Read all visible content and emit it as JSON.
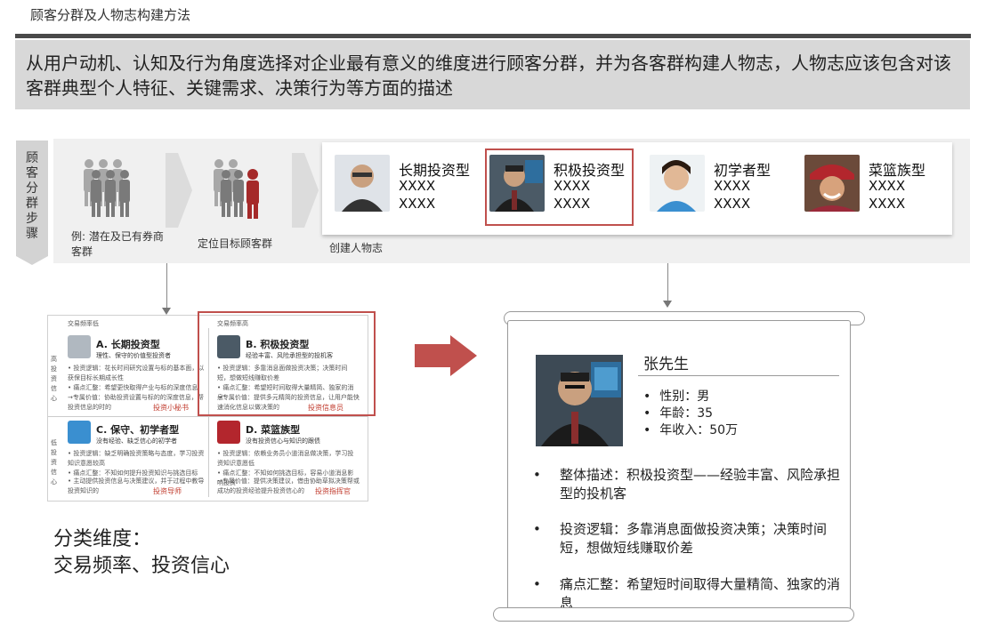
{
  "page_title": "顾客分群及人物志构建方法",
  "banner_text": "从用户动机、认知及行为角度选择对企业最有意义的维度进行顾客分群，并为各客群构建人物志，人物志应该包含对该客群典型个人特征、关键需求、决策行为等方面的描述",
  "steps_label": "顾客分群步骤",
  "steps": [
    {
      "caption": "例: 潜在及已有券商客群"
    },
    {
      "caption": "定位目标顾客群"
    }
  ],
  "personas_caption": "创建人物志",
  "personas": [
    {
      "name": "长期投资型",
      "line1": "XXXX",
      "line2": "XXXX"
    },
    {
      "name": "积极投资型",
      "line1": "XXXX",
      "line2": "XXXX"
    },
    {
      "name": "初学者型",
      "line1": "XXXX",
      "line2": "XXXX"
    },
    {
      "name": "菜篮族型",
      "line1": "XXXX",
      "line2": "XXXX"
    }
  ],
  "matrix": {
    "freq_low": "交易频率低",
    "freq_high": "交易频率高",
    "conf_high": "高投资信心",
    "conf_low": "低投资信心",
    "cells": [
      {
        "title": "A. 长期投资型",
        "sub": "理性、保守的价值型投资者",
        "lines": [
          "• 投资逻辑：花长时间研究设置与标的基本面，以获保目标长期成长性",
          "• 痛点汇整：希望更快取得产业与标的深度信息",
          "→专属价值：协助投资设置与标的的深度信息，帮投资信息的时的"
        ],
        "tag": "投资小秘书"
      },
      {
        "title": "B. 积极投资型",
        "sub": "经验丰富、风险承担型的投机客",
        "lines": [
          "• 投资逻辑：多靠消息面做投资决策；决策时间短，想做短线赚取价差",
          "• 痛点汇整：希望短时间取得大量精简、独家的消息",
          "→专属价值：提供多元精简的投资信息，让用户能快速消化信息以做决策的"
        ],
        "tag": "投资信息员"
      },
      {
        "title": "C. 保守、初学者型",
        "sub": "没有经验、缺乏信心的初学者",
        "lines": [
          "• 投资逻辑：缺乏明确投资策略与态度，学习投资知识意愿较高",
          "• 痛点汇整：不知如何提升投资知识与挑选目标",
          "• 主动提供投资信息与决策建议，并于过程中教导投资知识的"
        ],
        "tag": "投资导师"
      },
      {
        "title": "D. 菜篮族型",
        "sub": "没有投资信心与知识的跟债",
        "lines": [
          "• 投资逻辑：依赖业务员小道消息做决策，学习投资知识意愿低",
          "• 痛点汇整：不知如何挑选目标，容易小道消息影响投资",
          "→专属价值：提供决策建议，借由协助草拟决策帮或成功的投资经验提升投资信心的"
        ],
        "tag": "投资指挥官"
      }
    ]
  },
  "dimension_title": "分类维度：",
  "dimension_text": "交易频率、投资信心",
  "profile": {
    "name": "张先生",
    "attributes": [
      "性别：男",
      "年龄：35",
      "年收入：50万"
    ],
    "descriptions": [
      "整体描述：积极投资型——经验丰富、风险承担型的投机客",
      "投资逻辑：多靠消息面做投资决策；决策时间短，想做短线赚取价差",
      "痛点汇整：希望短时间取得大量精简、独家的消息"
    ]
  },
  "colors": {
    "accent_red": "#c0504d",
    "banner_gray": "#d8d8d8",
    "rule_dark": "#4a4a4a",
    "icon_gray": "#8c8c8c",
    "icon_red": "#a52a2a"
  }
}
